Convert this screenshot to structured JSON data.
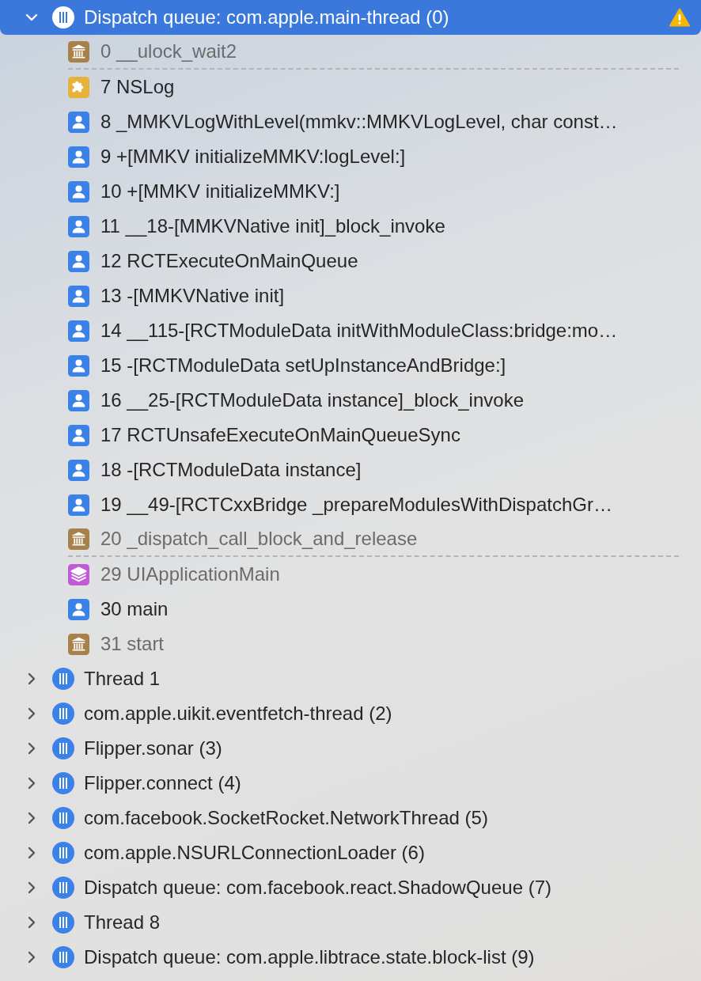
{
  "threads": [
    {
      "label": "Dispatch queue: com.apple.main-thread (0)",
      "expanded": true,
      "selected": true,
      "warning": true,
      "frames": [
        {
          "kind": "system",
          "text": "0 __ulock_wait2",
          "gap_after": true
        },
        {
          "kind": "framework",
          "text": "7 NSLog",
          "gap_after": false
        },
        {
          "kind": "user",
          "text": "8 _MMKVLogWithLevel(mmkv::MMKVLogLevel, char const…",
          "gap_after": false
        },
        {
          "kind": "user",
          "text": "9 +[MMKV initializeMMKV:logLevel:]",
          "gap_after": false
        },
        {
          "kind": "user",
          "text": "10 +[MMKV initializeMMKV:]",
          "gap_after": false
        },
        {
          "kind": "user",
          "text": "11 __18-[MMKVNative init]_block_invoke",
          "gap_after": false
        },
        {
          "kind": "user",
          "text": "12 RCTExecuteOnMainQueue",
          "gap_after": false
        },
        {
          "kind": "user",
          "text": "13 -[MMKVNative init]",
          "gap_after": false
        },
        {
          "kind": "user",
          "text": "14 __115-[RCTModuleData initWithModuleClass:bridge:mo…",
          "gap_after": false
        },
        {
          "kind": "user",
          "text": "15 -[RCTModuleData setUpInstanceAndBridge:]",
          "gap_after": false
        },
        {
          "kind": "user",
          "text": "16 __25-[RCTModuleData instance]_block_invoke",
          "gap_after": false
        },
        {
          "kind": "user",
          "text": "17 RCTUnsafeExecuteOnMainQueueSync",
          "gap_after": false
        },
        {
          "kind": "user",
          "text": "18 -[RCTModuleData instance]",
          "gap_after": false
        },
        {
          "kind": "user",
          "text": "19 __49-[RCTCxxBridge _prepareModulesWithDispatchGr…",
          "gap_after": false
        },
        {
          "kind": "system",
          "text": "20 _dispatch_call_block_and_release",
          "gap_after": true
        },
        {
          "kind": "uikit",
          "text": "29 UIApplicationMain",
          "gap_after": false
        },
        {
          "kind": "user",
          "text": "30 main",
          "gap_after": false
        },
        {
          "kind": "system",
          "text": "31 start",
          "gap_after": false
        }
      ]
    },
    {
      "label": "Thread 1",
      "expanded": false,
      "selected": false,
      "warning": false
    },
    {
      "label": "com.apple.uikit.eventfetch-thread (2)",
      "expanded": false,
      "selected": false,
      "warning": false
    },
    {
      "label": "Flipper.sonar (3)",
      "expanded": false,
      "selected": false,
      "warning": false
    },
    {
      "label": "Flipper.connect (4)",
      "expanded": false,
      "selected": false,
      "warning": false
    },
    {
      "label": "com.facebook.SocketRocket.NetworkThread (5)",
      "expanded": false,
      "selected": false,
      "warning": false
    },
    {
      "label": "com.apple.NSURLConnectionLoader (6)",
      "expanded": false,
      "selected": false,
      "warning": false
    },
    {
      "label": "Dispatch queue: com.facebook.react.ShadowQueue (7)",
      "expanded": false,
      "selected": false,
      "warning": false
    },
    {
      "label": "Thread 8",
      "expanded": false,
      "selected": false,
      "warning": false
    },
    {
      "label": "Dispatch queue: com.apple.libtrace.state.block-list (9)",
      "expanded": false,
      "selected": false,
      "warning": false
    }
  ]
}
